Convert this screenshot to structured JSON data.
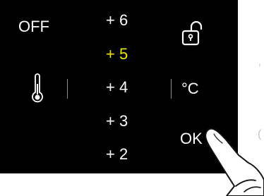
{
  "panel": {
    "background": "#000000",
    "off_label": "OFF",
    "unit_label": "°C",
    "ok_label": "OK"
  },
  "temperature_options": [
    {
      "label": "+ 6",
      "selected": false
    },
    {
      "label": "+ 5",
      "selected": true
    },
    {
      "label": "+ 4",
      "selected": false
    },
    {
      "label": "+ 3",
      "selected": false
    },
    {
      "label": "+ 2",
      "selected": false
    }
  ],
  "icons": {
    "thermometer": "thermometer-icon",
    "lock": "unlocked-padlock-icon",
    "hand": "pointing-hand-icon"
  },
  "colors": {
    "text": "#ffffff",
    "selected": "#f2e600",
    "divider": "#8a8a8a"
  }
}
